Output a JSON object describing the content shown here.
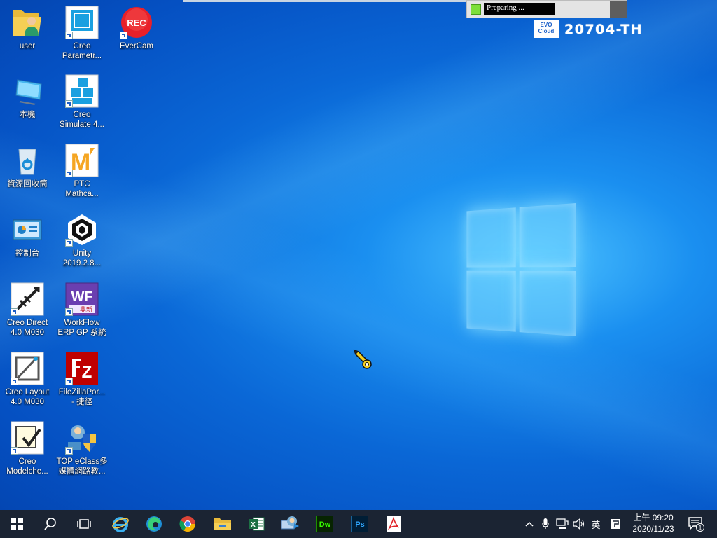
{
  "top_overlay": {
    "progress_text": "Preparing ...",
    "evo_badge": "EVO\nCloud",
    "hostname": "20704-TH"
  },
  "desktop_icons": [
    {
      "label": "user",
      "icon": "user-folder-icon"
    },
    {
      "label": "Creo\nParametr...",
      "icon": "creo-parametric-icon"
    },
    {
      "label": "EverCam",
      "icon": "evercam-icon",
      "badge": "REC"
    },
    {
      "label": "本機",
      "icon": "this-pc-icon"
    },
    {
      "label": "Creo\nSimulate 4...",
      "icon": "creo-simulate-icon"
    },
    {
      "label": "資源回收筒",
      "icon": "recycle-bin-icon"
    },
    {
      "label": "PTC\nMathca...",
      "icon": "ptc-mathcad-icon",
      "badge": "M"
    },
    {
      "label": "控制台",
      "icon": "control-panel-icon"
    },
    {
      "label": "Unity\n2019.2.8...",
      "icon": "unity-icon"
    },
    {
      "label": "Creo Direct\n4.0 M030",
      "icon": "creo-direct-icon"
    },
    {
      "label": "WorkFlow\nERP GP 系統",
      "icon": "workflow-erp-icon",
      "badge": "WF",
      "sub_badge": "鼎新"
    },
    {
      "label": "Creo Layout\n4.0 M030",
      "icon": "creo-layout-icon"
    },
    {
      "label": "FileZillaPor...\n- 捷徑",
      "icon": "filezilla-icon",
      "badge": "Z"
    },
    {
      "label": "Creo\nModelche...",
      "icon": "creo-modelcheck-icon"
    },
    {
      "label": "TOP eClass多\n媒體網路教...",
      "icon": "top-eclass-icon"
    }
  ],
  "taskbar": {
    "apps": [
      {
        "icon": "windows-start-icon"
      },
      {
        "icon": "search-icon"
      },
      {
        "icon": "task-view-icon"
      },
      {
        "icon": "internet-explorer-icon"
      },
      {
        "icon": "edge-icon"
      },
      {
        "icon": "chrome-icon"
      },
      {
        "icon": "file-explorer-icon"
      },
      {
        "icon": "excel-icon",
        "badge": "X"
      },
      {
        "icon": "remote-app-icon"
      },
      {
        "icon": "dreamweaver-icon",
        "badge": "Dw"
      },
      {
        "icon": "photoshop-icon",
        "badge": "Ps"
      },
      {
        "icon": "acrobat-icon"
      }
    ],
    "ime_label": "英",
    "clock_time": "上午 09:20",
    "clock_date": "2020/11/23",
    "notification_count": "1"
  },
  "colors": {
    "taskbar_bg": "#1b2433",
    "desktop_blue": "#0a67d6",
    "progress_green": "#7ddf3a"
  }
}
